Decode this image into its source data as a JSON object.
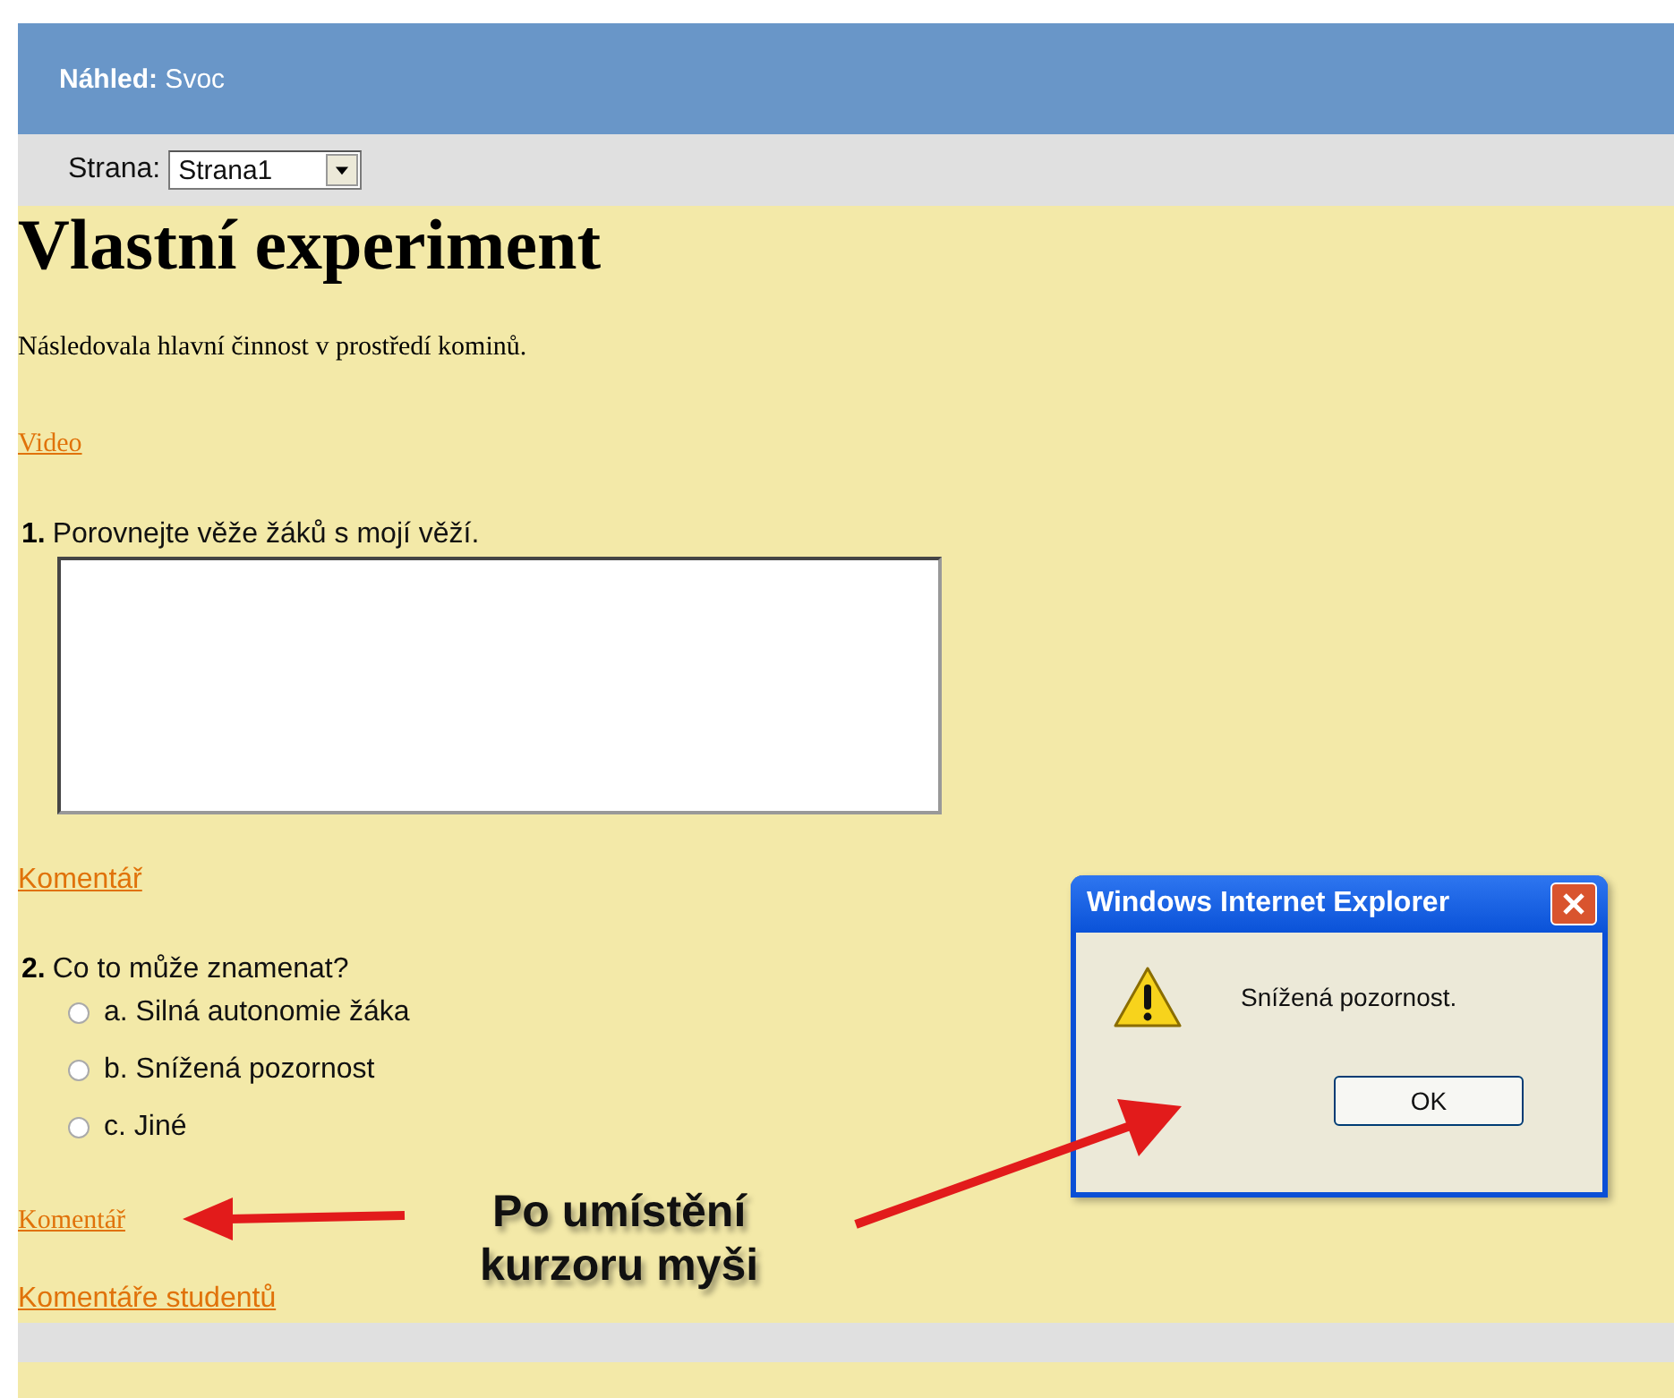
{
  "header": {
    "title": "**Náhled:** Svoc"
  },
  "page_select": {
    "label": "Strana:",
    "value": "Strana1"
  },
  "heading": "Vlastní experiment",
  "intro": "Následovala hlavní činnost v prostředí kominů.",
  "video_link": "Video",
  "questions": [
    {
      "kind": "text",
      "number": "1.",
      "text": "Porovnejte věže žáků s mojí věží.",
      "comment_link": "Komentář"
    },
    {
      "kind": "choice",
      "number": "2.",
      "text": "Co to může znamenat?",
      "options": [
        {
          "label": "a. Silná autonomie žáka",
          "selected": false
        },
        {
          "label": "b. Snížená pozornost",
          "selected": false
        },
        {
          "label": "c. Jiné",
          "selected": false
        }
      ],
      "comment_link": "Komentář"
    }
  ],
  "student_comments_link": "Komentáře studentů",
  "dialog": {
    "title": "Windows Internet Explorer",
    "message": "Snížená pozornost.",
    "button": "OK"
  },
  "annotation": {
    "lines": [
      "Po umístění",
      "kurzoru myši"
    ]
  }
}
